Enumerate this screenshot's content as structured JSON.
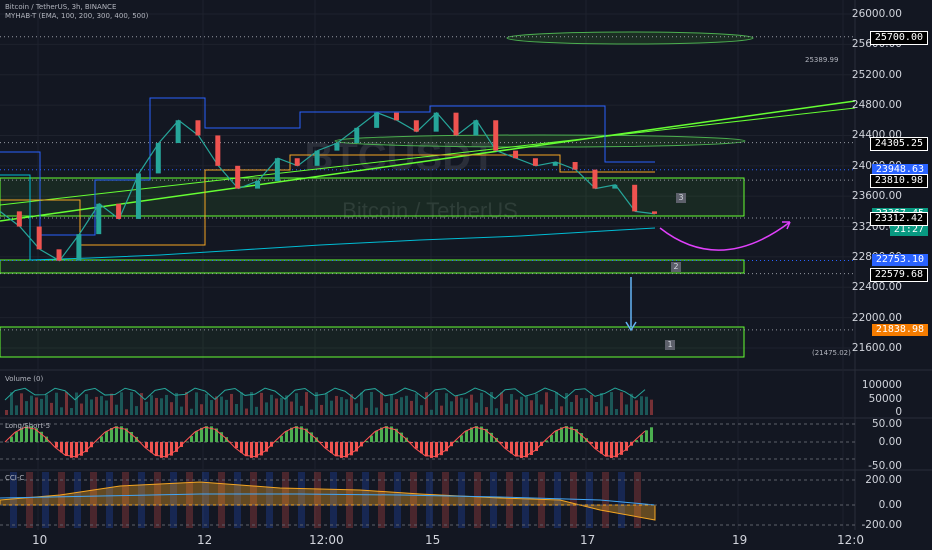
{
  "header": {
    "symbol_line": "Bitcoin / TetherUS, 3h, BINANCE",
    "indicator_line": "MYHAB-T (EMA, 100, 200, 300, 400, 500)"
  },
  "watermark": {
    "ticker": "BTCUSDT",
    "name": "Bitcoin / TetherUS"
  },
  "colors": {
    "bg": "#131722",
    "up": "#26a69a",
    "down": "#ef5350",
    "green_line": "#66ff33",
    "blue": "#2962ff",
    "orange": "#f5a623",
    "magenta": "#e040fb"
  },
  "chart_data": [
    {
      "type": "line",
      "title": "Bitcoin / TetherUS, 3h, BINANCE",
      "x_tick_labels": [
        "10",
        "12",
        "12:00",
        "15",
        "17",
        "19",
        "12:0"
      ],
      "y_tick_labels": [
        "26000.00",
        "25600.00",
        "25200.00",
        "24800.00",
        "24400.00",
        "24000.00",
        "23600.00",
        "23200.00",
        "22800.00",
        "22400.00",
        "22000.00",
        "21600.00"
      ],
      "ylim": [
        21450,
        26100
      ],
      "price_tags": [
        {
          "value": "25700.00",
          "style": "black"
        },
        {
          "value": "24305.25",
          "style": "black"
        },
        {
          "value": "23948.63",
          "style": "blue"
        },
        {
          "value": "23810.98",
          "style": "black"
        },
        {
          "value": "23367.45",
          "style": "green"
        },
        {
          "value": "21:27",
          "style": "green"
        },
        {
          "value": "23312.42",
          "style": "black"
        },
        {
          "value": "22753.10",
          "style": "blue"
        },
        {
          "value": "22579.68",
          "style": "black"
        },
        {
          "value": "21838.98",
          "style": "orange"
        }
      ],
      "annotations": [
        "25389.99",
        "(21475.02)",
        "3",
        "2",
        "1"
      ],
      "series": [
        {
          "values": [
            23400,
            23200,
            22900,
            22750,
            23100,
            23500,
            23300,
            23900,
            24300,
            24600,
            24400,
            24000,
            23700,
            23800,
            24100,
            24000,
            24200,
            24300,
            24500,
            24700,
            24600,
            24450,
            24700,
            24400,
            24600,
            24200,
            24100,
            24000,
            24050,
            23950,
            23700,
            23750,
            23400,
            23367
          ]
        }
      ]
    },
    {
      "type": "bar",
      "title": "Volume (0)",
      "y_tick_labels": [
        "100000",
        "50000",
        "0"
      ]
    },
    {
      "type": "bar",
      "title": "Long/Short-5",
      "y_tick_labels": [
        "50.00",
        "0.00",
        "-50.00"
      ]
    },
    {
      "type": "area",
      "title": "CCI-C",
      "y_tick_labels": [
        "200.00",
        "0.00",
        "-200.00"
      ]
    }
  ]
}
